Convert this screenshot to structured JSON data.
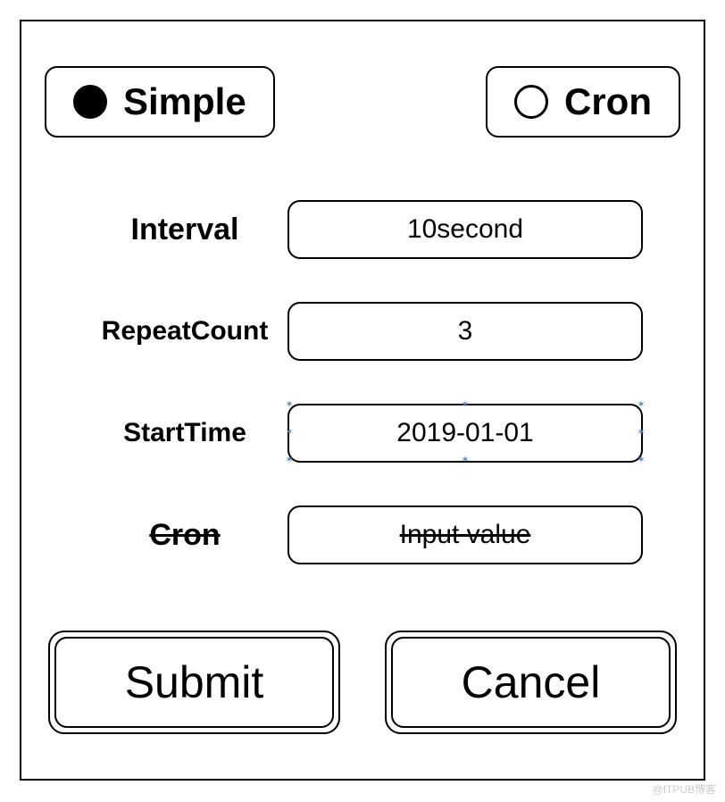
{
  "radio": {
    "simple": {
      "label": "Simple",
      "selected": true
    },
    "cron": {
      "label": "Cron",
      "selected": false
    }
  },
  "fields": {
    "interval": {
      "label": "Interval",
      "value": "10second"
    },
    "repeatCount": {
      "label": "RepeatCount",
      "value": "3"
    },
    "startTime": {
      "label": "StartTime",
      "value": "2019-01-01"
    },
    "cron": {
      "label": "Cron",
      "value": "Input value",
      "disabled": true
    }
  },
  "buttons": {
    "submit": "Submit",
    "cancel": "Cancel"
  },
  "watermark": "@ITPUB博客"
}
